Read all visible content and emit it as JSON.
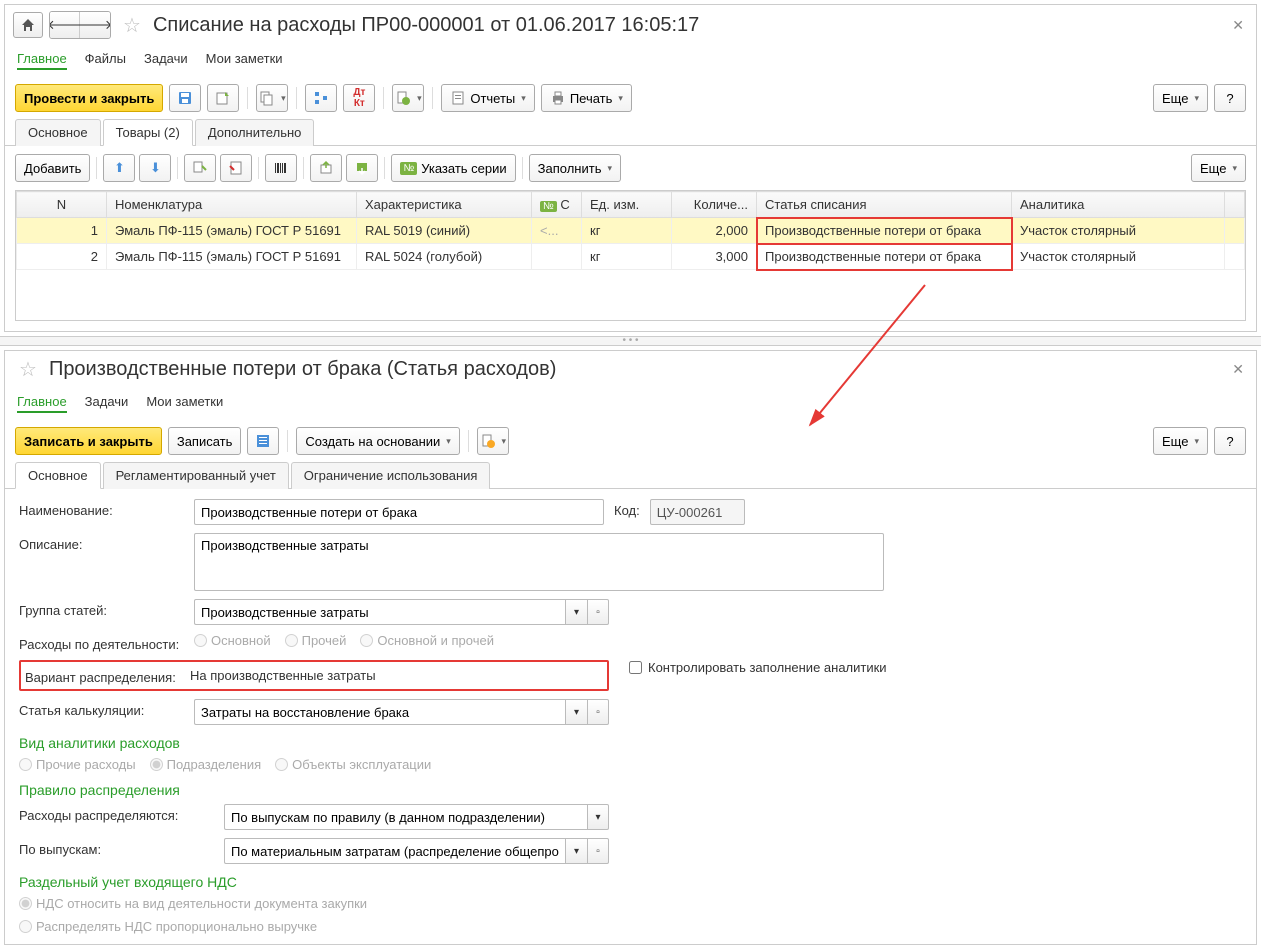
{
  "top": {
    "title": "Списание на расходы ПР00-000001 от 01.06.2017 16:05:17",
    "navTabs": [
      "Главное",
      "Файлы",
      "Задачи",
      "Мои заметки"
    ],
    "activeNavTab": 0,
    "toolbar": {
      "postClose": "Провести и закрыть",
      "reports": "Отчеты",
      "print": "Печать",
      "more": "Еще"
    },
    "subTabs": [
      "Основное",
      "Товары (2)",
      "Дополнительно"
    ],
    "activeSubTab": 1,
    "gridToolbar": {
      "add": "Добавить",
      "series": "Указать серии",
      "fill": "Заполнить",
      "more": "Еще"
    },
    "columns": {
      "n": "N",
      "nom": "Номенклатура",
      "char": "Характеристика",
      "c": "С",
      "unit": "Ед. изм.",
      "qty": "Количе...",
      "writeoff": "Статья списания",
      "analytics": "Аналитика"
    },
    "rows": [
      {
        "n": "1",
        "nom": "Эмаль ПФ-115 (эмаль) ГОСТ Р 51691",
        "char": "RAL 5019 (синий)",
        "c": "<...",
        "unit": "кг",
        "qty": "2,000",
        "writeoff": "Производственные потери от брака",
        "analytics": "Участок столярный"
      },
      {
        "n": "2",
        "nom": "Эмаль ПФ-115 (эмаль) ГОСТ Р 51691",
        "char": "RAL 5024 (голубой)",
        "c": "",
        "unit": "кг",
        "qty": "3,000",
        "writeoff": "Производственные потери от брака",
        "analytics": "Участок столярный"
      }
    ]
  },
  "bottom": {
    "title": "Производственные потери от брака (Статья расходов)",
    "navTabs": [
      "Главное",
      "Задачи",
      "Мои заметки"
    ],
    "activeNavTab": 0,
    "toolbar": {
      "saveClose": "Записать и закрыть",
      "save": "Записать",
      "createFrom": "Создать на основании",
      "more": "Еще"
    },
    "subTabs": [
      "Основное",
      "Регламентированный учет",
      "Ограничение использования"
    ],
    "activeSubTab": 0,
    "labels": {
      "name": "Наименование:",
      "code": "Код:",
      "desc": "Описание:",
      "group": "Группа статей:",
      "activity": "Расходы по деятельности:",
      "distVariant": "Вариант распределения:",
      "calcItem": "Статья калькуляции:",
      "controlAnalytics": "Контролировать заполнение аналитики",
      "analyticsKind": "Вид аналитики расходов",
      "distRule": "Правило распределения",
      "distBy": "Расходы распределяются:",
      "byOutput": "По выпускам:",
      "vatSection": "Раздельный учет входящего НДС"
    },
    "values": {
      "name": "Производственные потери от брака",
      "code": "ЦУ-000261",
      "desc": "Производственные затраты",
      "group": "Производственные затраты",
      "distVariant": "На производственные затраты",
      "calcItem": "Затраты на восстановление брака",
      "distBy": "По выпускам по правилу (в данном подразделении)",
      "byOutput": "По материальным затратам (распределение общепроизводс"
    },
    "activityRadios": [
      "Основной",
      "Прочей",
      "Основной и прочей"
    ],
    "analyticsRadios": [
      "Прочие расходы",
      "Подразделения",
      "Объекты эксплуатации"
    ],
    "analyticsSelected": 1,
    "vatRadios": [
      "НДС относить на вид деятельности документа закупки",
      "Распределять НДС пропорционально выручке"
    ],
    "vatSelected": 0
  }
}
